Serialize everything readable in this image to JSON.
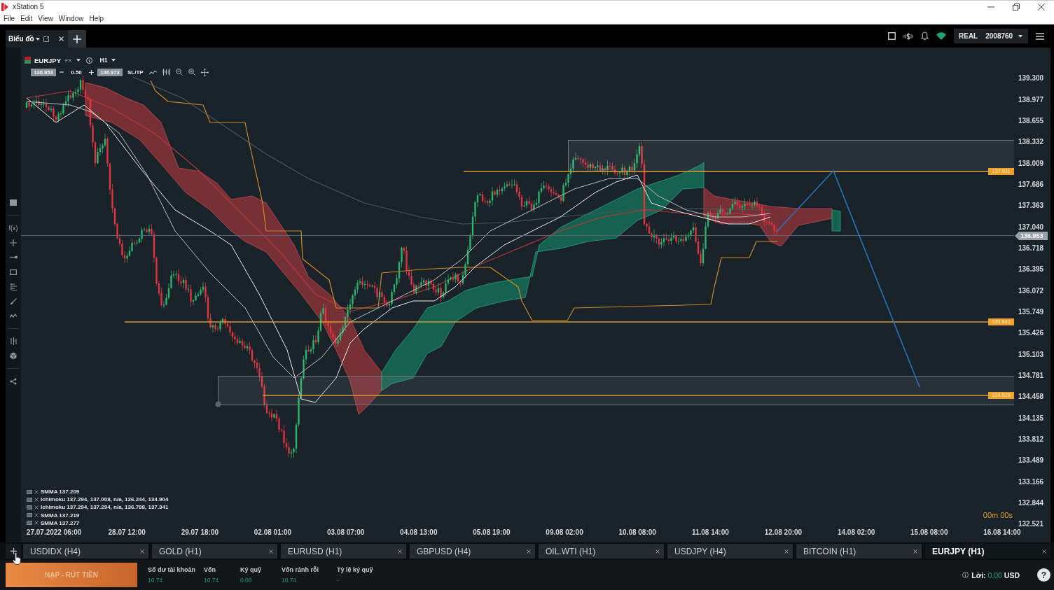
{
  "window": {
    "title": "xStation 5",
    "menu": [
      "File",
      "Edit",
      "View",
      "Window",
      "Help"
    ]
  },
  "top_bar": {
    "workspace_tab": "Biểu đồ",
    "account_type": "REAL",
    "account_number": "2008760"
  },
  "left_toolbar": {
    "function_button": "f(x)"
  },
  "chart": {
    "symbol": "EURJPY",
    "market": "FX",
    "timeframe": "H1",
    "sell_price": "136.953",
    "volume": "0.50",
    "buy_price": "136.973",
    "sltp_button": "SL/TP",
    "legend": [
      "SMMA 137.209",
      "Ichimoku 137.294, 137.008, n/a, 136.244, 134.904",
      "Ichimoku 137.294, 137.294, n/a, 136.788, 137.341",
      "SMMA 137.219",
      "SMMA 137.277"
    ],
    "price_axis": [
      "139.300",
      "138.977",
      "138.655",
      "138.332",
      "138.009",
      "137.686",
      "137.363",
      "137.040",
      "136.718",
      "136.395",
      "136.072",
      "135.749",
      "135.426",
      "135.103",
      "134.781",
      "134.458",
      "134.135",
      "133.812",
      "133.489",
      "133.166",
      "132.844",
      "132.521"
    ],
    "time_axis": [
      "27.07.2022 06:00",
      "28.07 12:00",
      "29.07 18:00",
      "02.08 01:00",
      "03.08 07:00",
      "04.08 13:00",
      "05.08 19:00",
      "09.08 02:00",
      "10.08 08:00",
      "11.08 14:00",
      "12.08 20:00",
      "14.08 02:00",
      "15.08 08:00",
      "16.08 14:00"
    ],
    "level_tags": [
      "137.911",
      "135.641",
      "134.528"
    ],
    "current_price": "136.953",
    "countdown": "00m 00s"
  },
  "tabs": [
    {
      "label": "USDIDX (H4)",
      "selected": false
    },
    {
      "label": "GOLD (H1)",
      "selected": false
    },
    {
      "label": "EURUSD (H1)",
      "selected": false
    },
    {
      "label": "GBPUSD (H4)",
      "selected": false
    },
    {
      "label": "OIL.WTI (H1)",
      "selected": false
    },
    {
      "label": "USDJPY (H4)",
      "selected": false
    },
    {
      "label": "BITCOIN (H1)",
      "selected": false
    },
    {
      "label": "EURJPY (H1)",
      "selected": true
    }
  ],
  "status_bar": {
    "deposit_button": "NẠP - RÚT TIỀN",
    "stats": [
      {
        "label": "Số dư tài khoản",
        "value": "10.74"
      },
      {
        "label": "Vốn",
        "value": "10.74"
      },
      {
        "label": "Ký quỹ",
        "value": "0.00"
      },
      {
        "label": "Vốn rảnh rỗi",
        "value": "10.74"
      },
      {
        "label": "Tỷ lệ ký quỹ",
        "value": "-"
      }
    ],
    "profit": {
      "label": "Lời:",
      "value": "0.00",
      "currency": "USD"
    },
    "help_button": "?"
  }
}
